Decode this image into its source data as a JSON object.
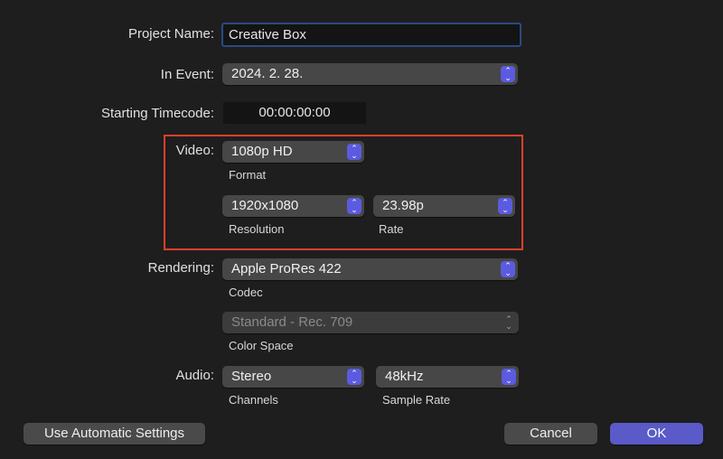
{
  "project_name": {
    "label": "Project Name:",
    "value": "Creative Box"
  },
  "in_event": {
    "label": "In Event:",
    "value": "2024. 2. 28."
  },
  "timecode": {
    "label": "Starting Timecode:",
    "value": "00:00:00:00"
  },
  "video": {
    "label": "Video:",
    "format": "1080p HD",
    "format_label": "Format",
    "resolution": "1920x1080",
    "resolution_label": "Resolution",
    "rate": "23.98p",
    "rate_label": "Rate"
  },
  "rendering": {
    "label": "Rendering:",
    "codec": "Apple ProRes 422",
    "codec_label": "Codec",
    "color_space": "Standard - Rec. 709",
    "color_space_label": "Color Space"
  },
  "audio": {
    "label": "Audio:",
    "channels": "Stereo",
    "channels_label": "Channels",
    "sample_rate": "48kHz",
    "sample_rate_label": "Sample Rate"
  },
  "buttons": {
    "automatic": "Use Automatic Settings",
    "cancel": "Cancel",
    "ok": "OK"
  },
  "colors": {
    "accent": "#5b5be0",
    "highlight_box": "#e0402a",
    "focus_ring": "#2a4a80"
  }
}
